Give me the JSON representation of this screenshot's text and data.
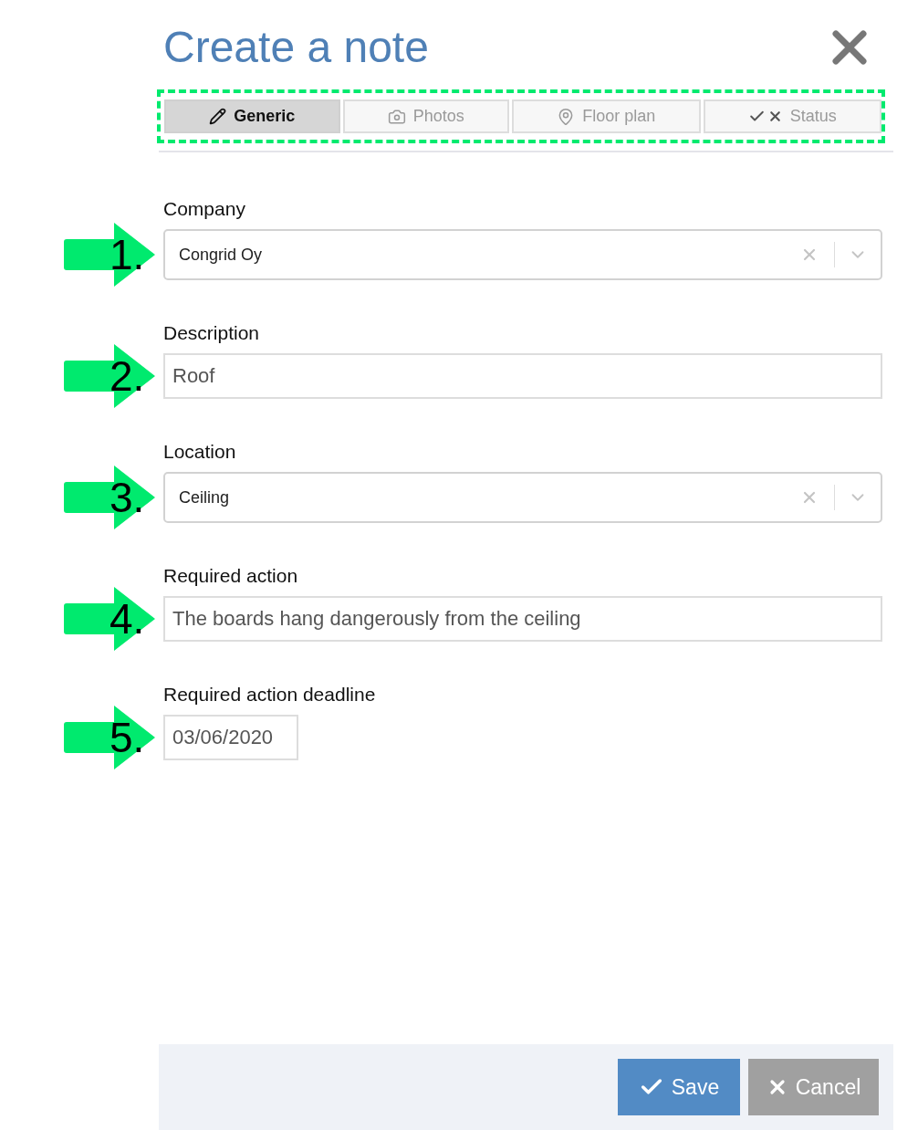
{
  "dialog": {
    "title": "Create a note"
  },
  "tab_bar": {
    "highlighted": true,
    "tabs": [
      {
        "label": "Generic",
        "selected": true
      },
      {
        "label": "Photos",
        "selected": false
      },
      {
        "label": "Floor plan",
        "selected": false
      },
      {
        "label": "Status",
        "selected": false
      }
    ]
  },
  "fields": [
    {
      "kind": "select",
      "label": "Company",
      "value": "Congrid Oy",
      "marker": "1."
    },
    {
      "kind": "text",
      "label": "Description",
      "value": "Roof",
      "marker": "2."
    },
    {
      "kind": "select",
      "label": "Location",
      "value": "Ceiling",
      "marker": "3."
    },
    {
      "kind": "text",
      "label": "Required action",
      "value": "The boards hang dangerously from the ceiling",
      "marker": "4."
    },
    {
      "kind": "date",
      "label": "Required action deadline",
      "value": "03/06/2020",
      "marker": "5."
    }
  ],
  "footer": {
    "buttons": [
      {
        "kind": "save",
        "label": "Save"
      },
      {
        "kind": "cancel",
        "label": "Cancel"
      }
    ]
  }
}
